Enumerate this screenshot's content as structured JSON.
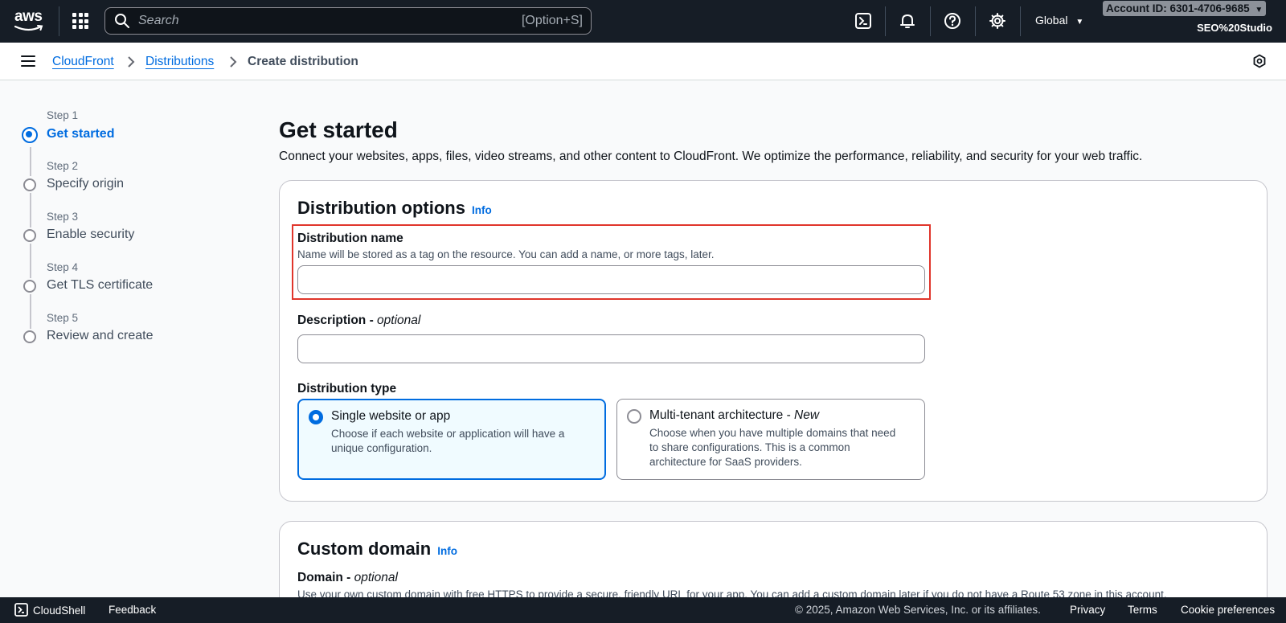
{
  "topnav": {
    "logo_text": "aws",
    "search_placeholder": "Search",
    "search_shortcut": "[Option+S]",
    "region": "Global",
    "account_id": "Account ID: 6301-4706-9685",
    "account_user": "SEO%20Studio"
  },
  "breadcrumb": {
    "items": [
      "CloudFront",
      "Distributions",
      "Create distribution"
    ]
  },
  "steps": [
    {
      "num": "Step 1",
      "label": "Get started",
      "active": true
    },
    {
      "num": "Step 2",
      "label": "Specify origin",
      "active": false
    },
    {
      "num": "Step 3",
      "label": "Enable security",
      "active": false
    },
    {
      "num": "Step 4",
      "label": "Get TLS certificate",
      "active": false
    },
    {
      "num": "Step 5",
      "label": "Review and create",
      "active": false
    }
  ],
  "page": {
    "title": "Get started",
    "description": "Connect your websites, apps, files, video streams, and other content to CloudFront. We optimize the performance, reliability, and security for your web traffic."
  },
  "distribution_options": {
    "title": "Distribution options",
    "info": "Info",
    "name_label": "Distribution name",
    "name_hint": "Name will be stored as a tag on the resource. You can add a name, or more tags, later.",
    "name_value": "",
    "description_label": "Description - ",
    "description_optional": "optional",
    "description_value": "",
    "type_label": "Distribution type",
    "types": [
      {
        "title": "Single website or app",
        "suffix": "",
        "desc": "Choose if each website or application will have a unique configuration.",
        "selected": true
      },
      {
        "title": "Multi-tenant architecture - ",
        "suffix": "New",
        "desc": "Choose when you have multiple domains that need to share configurations. This is a common architecture for SaaS providers.",
        "selected": false
      }
    ]
  },
  "custom_domain": {
    "title": "Custom domain",
    "info": "Info",
    "domain_label": "Domain - ",
    "domain_optional": "optional",
    "domain_hint": "Use your own custom domain with free HTTPS to provide a secure, friendly URL for your app. You can add a custom domain later if you do not have a Route 53 zone in this account."
  },
  "footer": {
    "cloudshell": "CloudShell",
    "feedback": "Feedback",
    "copyright": "© 2025, Amazon Web Services, Inc. or its affiliates.",
    "privacy": "Privacy",
    "terms": "Terms",
    "cookies": "Cookie preferences"
  },
  "colors": {
    "nav_bg": "#161d26",
    "link": "#006ce0",
    "highlight": "#e0352b",
    "selected_tile_bg": "#f0fbff"
  }
}
